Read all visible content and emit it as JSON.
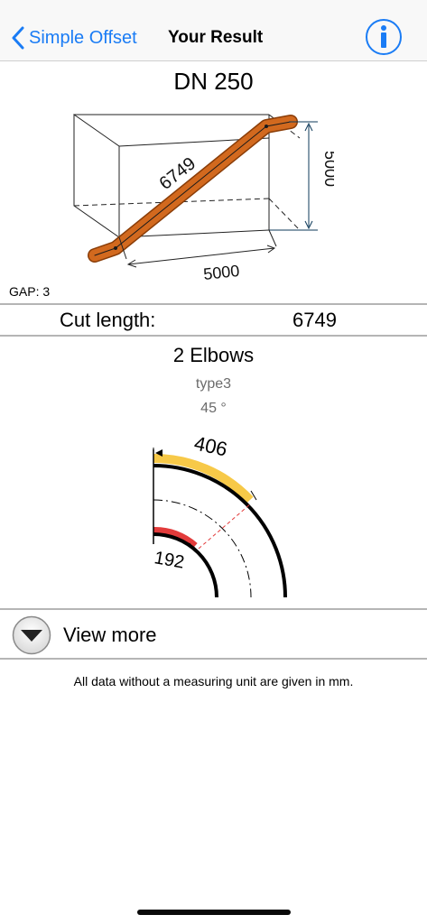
{
  "nav": {
    "back_label": "Simple Offset",
    "title": "Your Result"
  },
  "result": {
    "dn": "DN 250",
    "diagonal": "6749",
    "height": "5000",
    "width": "5000",
    "gap": "GAP: 3",
    "cut_label": "Cut length:",
    "cut_value": "6749"
  },
  "elbows": {
    "title": "2 Elbows",
    "type": "type3",
    "angle": "45 °",
    "outer_length": "406",
    "inner_length": "192"
  },
  "view_more": {
    "label": "View more"
  },
  "footnote": "All data without a measuring unit are given in mm.",
  "colors": {
    "accent": "#1a7cf5",
    "pipe": "#d2691e",
    "outer_highlight": "#f7c948",
    "inner_highlight": "#e23b3b"
  }
}
